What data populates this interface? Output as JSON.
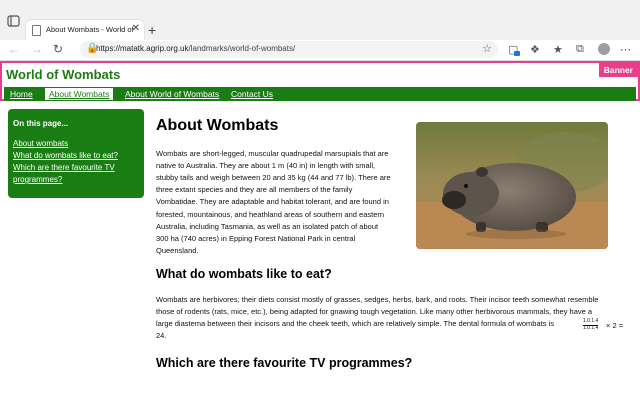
{
  "browser": {
    "tab_title": "About Wombats - World of Wombats",
    "tab_close": "✕",
    "new_tab": "+",
    "url_host": "https://matatk.agrip.org.uk",
    "url_path": "/landmarks/world-of-wombats/"
  },
  "site": {
    "title": "World of Wombats",
    "banner_tag": "Banner",
    "nav": [
      "Home",
      "About Wombats",
      "About World of Wombats",
      "Contact Us"
    ]
  },
  "sidebar": {
    "heading": "On this page...",
    "links": [
      "About wombats",
      "What do wombats like to eat?",
      "Which are there favourite TV",
      "programmes?"
    ]
  },
  "article": {
    "title": "About Wombats",
    "intro_lines": [
      "Wombats are short-legged, muscular quadrupedal marsupials that are",
      "native to Australia. They are about 1 m (40 in) in length with small,",
      "stubby tails and weigh between 20 and 35 kg (44 and 77 lb). There are",
      "three extant species and they are all members of the family",
      "Vombatidae. They are adaptable and habitat tolerant, and are found in",
      "forested, mountainous, and heathland areas of southern and eastern",
      "Australia, including Tasmania, as well as an isolated patch of about",
      "300 ha (740 acres) in Epping Forest National Park in central",
      "Queensland."
    ],
    "h2_eat": "What do wombats like to eat?",
    "eat_lines": [
      "Wombats are herbivores; their diets consist mostly of grasses, sedges, herbs, bark, and roots. Their incisor teeth somewhat resemble",
      "those of rodents (rats, mice, etc.), being adapted for gnawing tough vegetation. Like many other herbivorous mammals, they have a",
      "large diastema between their incisors and the cheek teeth, which are relatively simple. The dental formula of wombats is",
      "24."
    ],
    "dental_top": "1.0.1.4",
    "dental_bottom": "1.0.1.4",
    "dental_suffix": "× 2 =",
    "h2_tv": "Which are there favourite TV programmes?"
  },
  "colors": {
    "green": "#1a7d13",
    "banner_pink": "#e83e8c"
  }
}
